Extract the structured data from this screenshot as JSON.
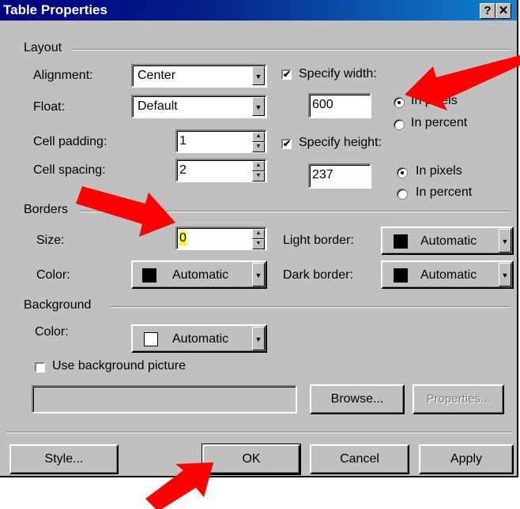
{
  "dialog": {
    "title": "Table Properties",
    "help_glyph": "?",
    "close_glyph": "✕"
  },
  "layout": {
    "group_label": "Layout",
    "alignment": {
      "label": "Alignment:",
      "value": "Center"
    },
    "float": {
      "label": "Float:",
      "value": "Default"
    },
    "cell_padding": {
      "label": "Cell padding:",
      "value": "1"
    },
    "cell_spacing": {
      "label": "Cell spacing:",
      "value": "2"
    },
    "specify_width": {
      "label": "Specify width:",
      "checked": true,
      "value": "600",
      "pixels_label": "In pixels",
      "percent_label": "In percent",
      "selected": "pixels"
    },
    "specify_height": {
      "label": "Specify height:",
      "checked": true,
      "value": "237",
      "pixels_label": "In pixels",
      "percent_label": "In percent",
      "selected": "pixels"
    }
  },
  "borders": {
    "group_label": "Borders",
    "size": {
      "label": "Size:",
      "value": "0"
    },
    "color": {
      "label": "Color:",
      "value": "Automatic",
      "swatch": "#000000"
    },
    "light_border": {
      "label": "Light border:",
      "value": "Automatic",
      "swatch": "#000000"
    },
    "dark_border": {
      "label": "Dark border:",
      "value": "Automatic",
      "swatch": "#000000"
    }
  },
  "background": {
    "group_label": "Background",
    "color": {
      "label": "Color:",
      "value": "Automatic",
      "swatch": "#ffffff"
    },
    "use_picture": {
      "label": "Use background picture",
      "checked": false
    },
    "picture_path": "",
    "browse_label": "Browse...",
    "properties_label": "Properties..."
  },
  "buttons": {
    "style": "Style...",
    "ok": "OK",
    "cancel": "Cancel",
    "apply": "Apply"
  },
  "annotations": {
    "arrow_color": "#ff0000"
  },
  "icons": {
    "checkmark": "✔",
    "dropdown_arrow": "▼",
    "spin_up": "▲",
    "spin_down": "▼"
  }
}
